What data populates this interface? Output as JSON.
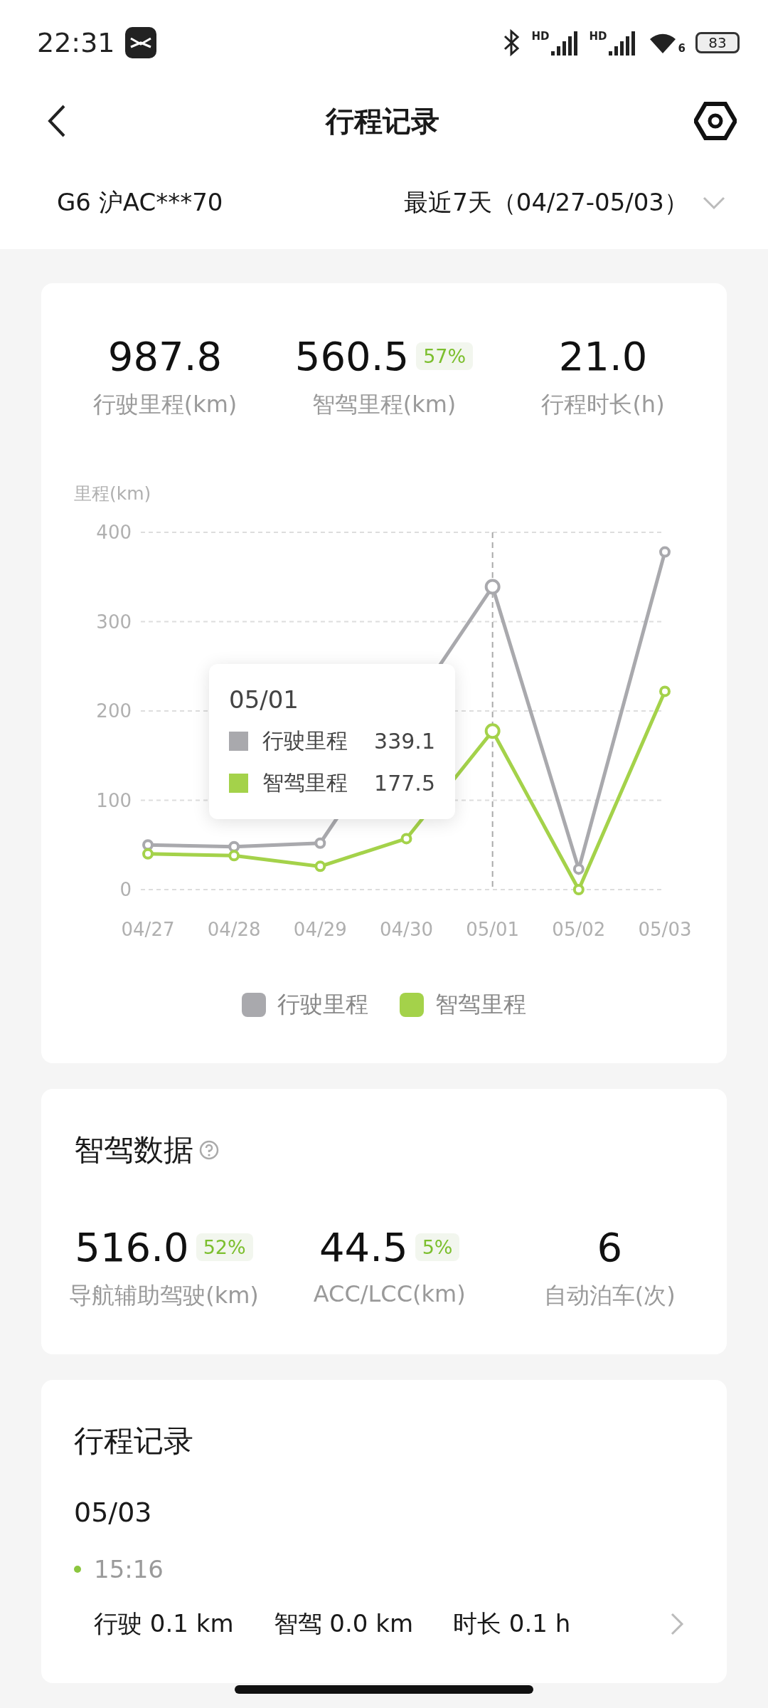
{
  "status_bar": {
    "time": "22:31",
    "signal_labels": [
      "HD",
      "HD"
    ],
    "wifi_label": "6",
    "battery": "83"
  },
  "header": {
    "title": "行程记录"
  },
  "filter": {
    "vehicle": "G6 沪AC***70",
    "range": "最近7天（04/27-05/03）"
  },
  "summary": [
    {
      "value": "987.8",
      "label": "行驶里程(km)"
    },
    {
      "value": "560.5",
      "badge": "57%",
      "label": "智驾里程(km)"
    },
    {
      "value": "21.0",
      "label": "行程时长(h)"
    }
  ],
  "mileage_chart": {
    "chart_data": {
      "type": "line",
      "ylabel": "里程(km)",
      "categories": [
        "04/27",
        "04/28",
        "04/29",
        "04/30",
        "05/01",
        "05/02",
        "05/03"
      ],
      "ylim": [
        0,
        400
      ],
      "yticks": [
        0,
        100,
        200,
        300,
        400
      ],
      "grid": true,
      "legend": true,
      "ref_lines": [
        {
          "axis": "x",
          "value": "05/01"
        }
      ],
      "series": [
        {
          "name": "行驶里程",
          "color": "#a9a9ad",
          "marker": "circle",
          "values": [
            50,
            48,
            52,
            null,
            339.1,
            23,
            378
          ]
        },
        {
          "name": "智驾里程",
          "color": "#a4d24a",
          "marker": "circle",
          "values": [
            40,
            38,
            26,
            57,
            177.5,
            0,
            222
          ]
        }
      ]
    },
    "tooltip": {
      "date": "05/01",
      "rows": [
        {
          "name": "行驶里程",
          "value": "339.1",
          "color": "#a9a9ad"
        },
        {
          "name": "智驾里程",
          "value": "177.5",
          "color": "#a4d24a"
        }
      ]
    }
  },
  "smart_drive": {
    "title": "智驾数据",
    "stats": [
      {
        "value": "516.0",
        "badge": "52%",
        "label": "导航辅助驾驶(km)"
      },
      {
        "value": "44.5",
        "badge": "5%",
        "label": "ACC/LCC(km)"
      },
      {
        "value": "6",
        "label": "自动泊车(次)"
      }
    ]
  },
  "trips": {
    "title": "行程记录",
    "date": "05/03",
    "items": [
      {
        "time": "15:16",
        "metrics": [
          "行驶 0.1 km",
          "智驾 0.0 km",
          "时长 0.1 h"
        ]
      }
    ]
  }
}
